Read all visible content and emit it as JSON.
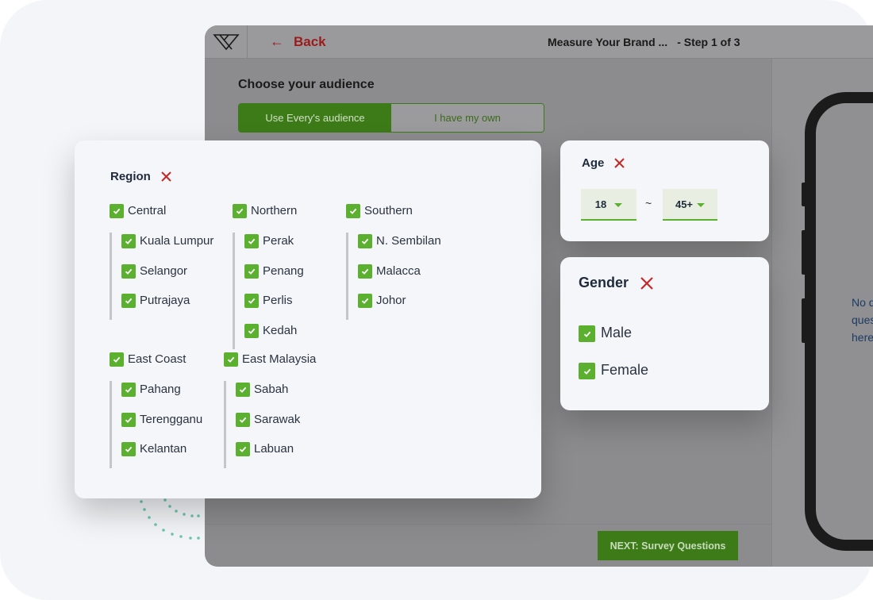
{
  "topbar": {
    "back_label": "Back",
    "title": "Measure Your Brand ...",
    "step": "- Step 1 of 3"
  },
  "audience": {
    "heading": "Choose your audience",
    "toggle_active": "Use Every's audience",
    "toggle_inactive": "I have my own"
  },
  "region": {
    "heading": "Region",
    "groups": [
      {
        "label": "Central",
        "items": [
          "Kuala Lumpur",
          "Selangor",
          "Putrajaya"
        ]
      },
      {
        "label": "Northern",
        "items": [
          "Perak",
          "Penang",
          "Perlis",
          "Kedah"
        ]
      },
      {
        "label": "Southern",
        "items": [
          "N. Sembilan",
          "Malacca",
          "Johor"
        ]
      },
      {
        "label": "East Coast",
        "items": [
          "Pahang",
          "Terengganu",
          "Kelantan"
        ]
      },
      {
        "label": "East Malaysia",
        "items": [
          "Sabah",
          "Sarawak",
          "Labuan"
        ]
      }
    ]
  },
  "age": {
    "heading": "Age",
    "from": "18",
    "separator": "~",
    "to": "45+"
  },
  "gender": {
    "heading": "Gender",
    "options": [
      "Male",
      "Female"
    ]
  },
  "footer": {
    "next_label": "NEXT: Survey Questions"
  },
  "preview": {
    "line1": "No q",
    "line2": "ques",
    "line3": "here"
  },
  "colors": {
    "accent_green": "#5bb02f",
    "dark_green": "#3d7a18",
    "close_red": "#c62828",
    "back_red": "#9b1b1b"
  }
}
